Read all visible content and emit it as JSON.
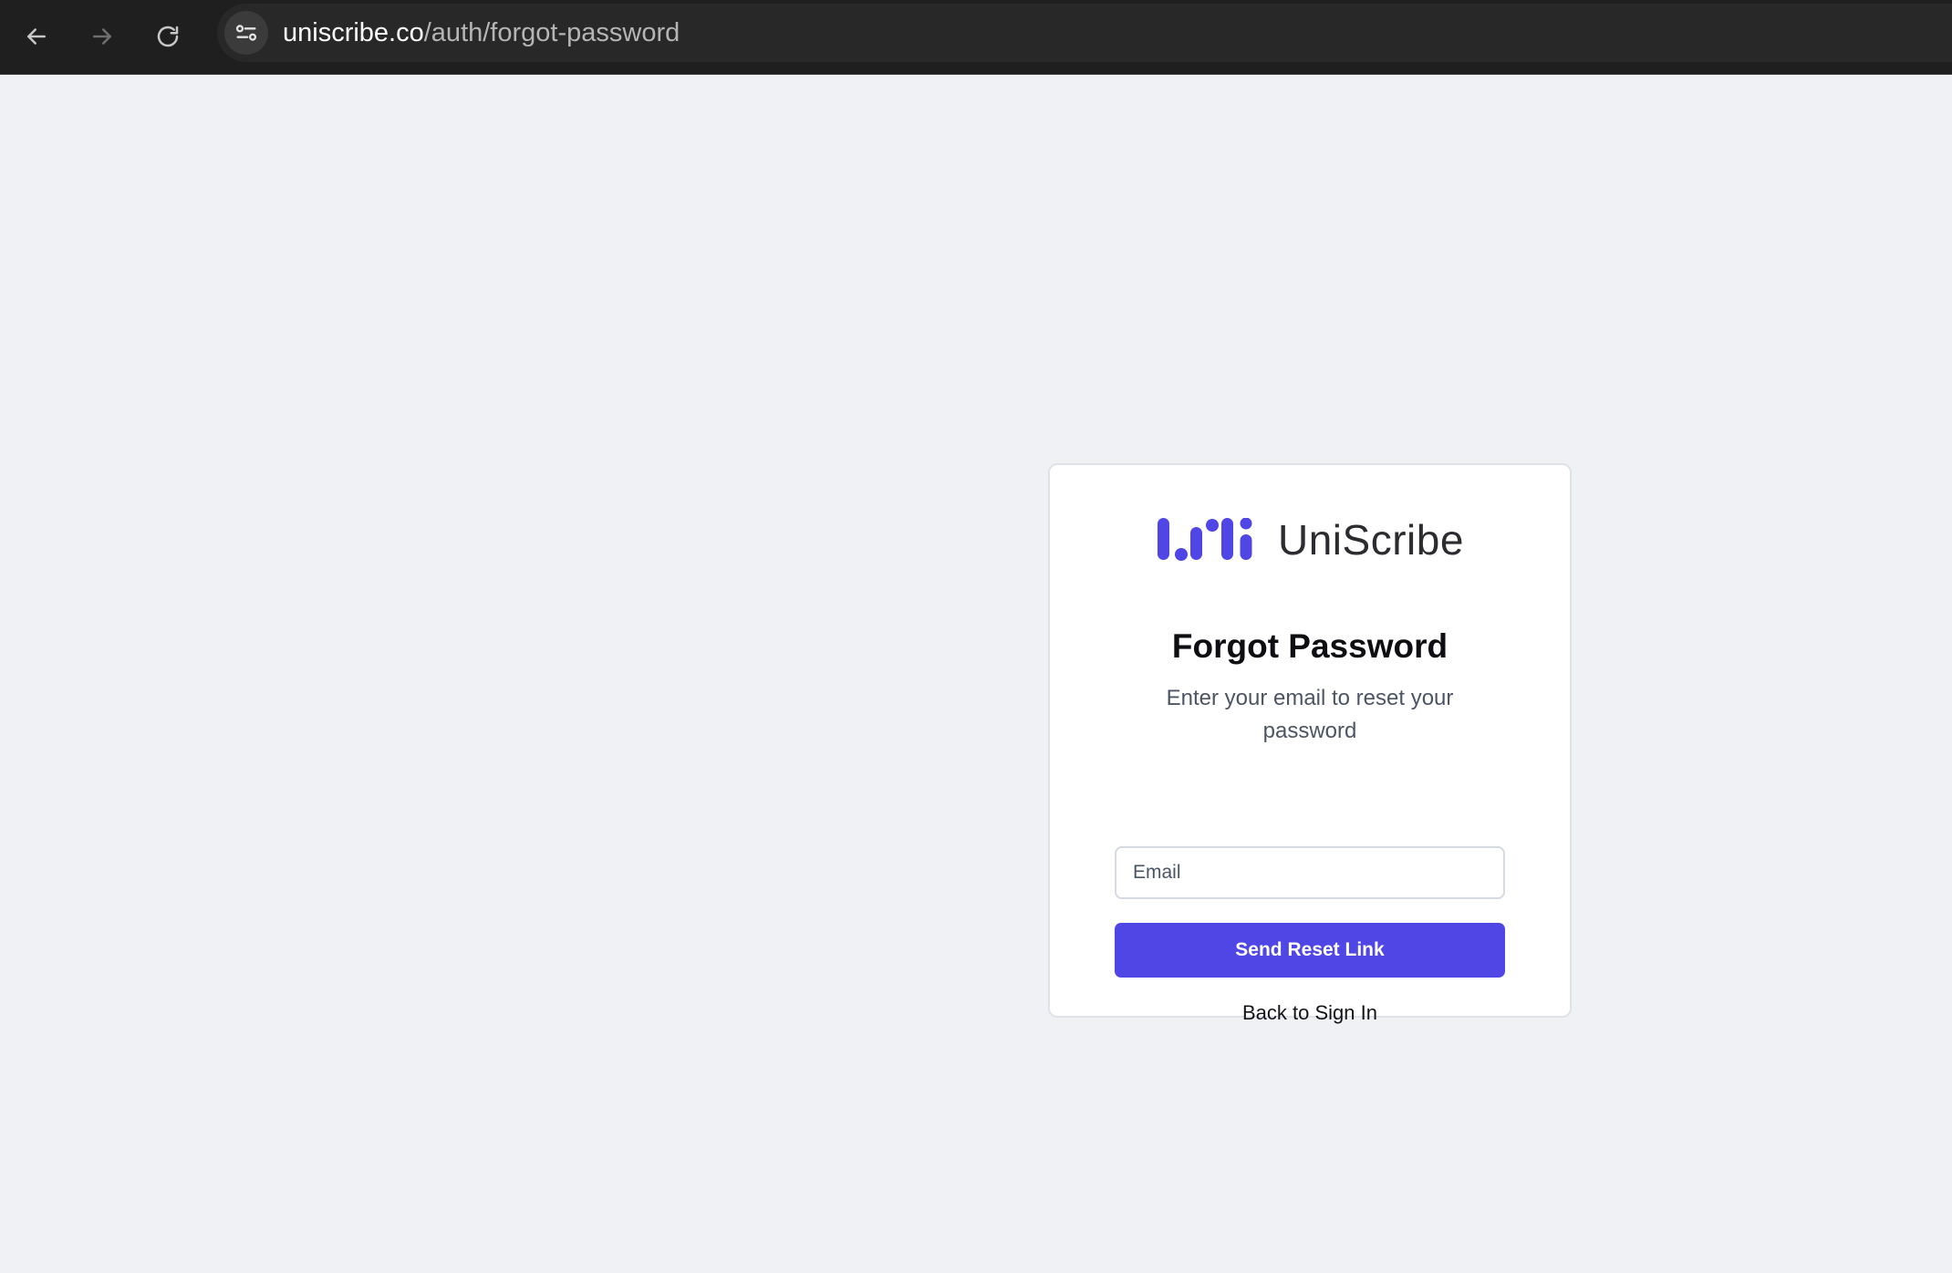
{
  "browser": {
    "url_domain": "uniscribe.co",
    "url_path": "/auth/forgot-password",
    "icons": [
      "back-arrow-icon",
      "forward-arrow-icon",
      "reload-icon",
      "site-settings-icon"
    ]
  },
  "card": {
    "brand_name": "UniScribe",
    "logo_icon": "uniscribe-logo-icon",
    "title": "Forgot Password",
    "subtitle": "Enter your email to reset your password",
    "email_placeholder": "Email",
    "email_value": "",
    "submit_label": "Send Reset Link",
    "back_link_label": "Back to Sign In"
  },
  "colors": {
    "accent": "#4f46e5",
    "page_background": "#f0f1f5",
    "browser_bar": "#1f1f1f"
  }
}
